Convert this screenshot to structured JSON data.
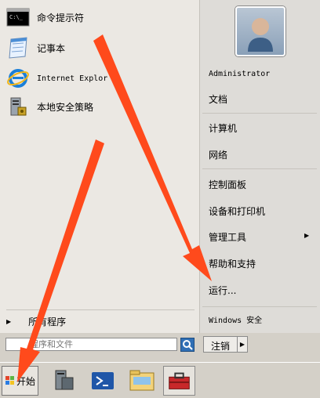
{
  "programs": [
    {
      "label": "命令提示符",
      "icon": "cmd-icon"
    },
    {
      "label": "记事本",
      "icon": "notepad-icon"
    },
    {
      "label": "Internet Explor",
      "icon": "internet-explorer-icon"
    },
    {
      "label": "本地安全策略",
      "icon": "local-security-policy-icon"
    }
  ],
  "all_programs_label": "所有程序",
  "search": {
    "value": "",
    "placeholder": "程序和文件"
  },
  "right_items": {
    "user": "Administrator",
    "documents": "文档",
    "computer": "计算机",
    "network": "网络",
    "control_panel": "控制面板",
    "devices_printers": "设备和打印机",
    "admin_tools": "管理工具",
    "help_support": "帮助和支持",
    "run": "运行...",
    "windows_security": "Windows 安全"
  },
  "logoff_label": "注销",
  "start_label": "开始",
  "taskbar_icons": [
    "server-manager-icon",
    "powershell-icon",
    "explorer-icon",
    "toolbox-icon"
  ],
  "colors": {
    "annotation_arrow": "#ff4a1c",
    "accent": "#2f6fb5"
  }
}
